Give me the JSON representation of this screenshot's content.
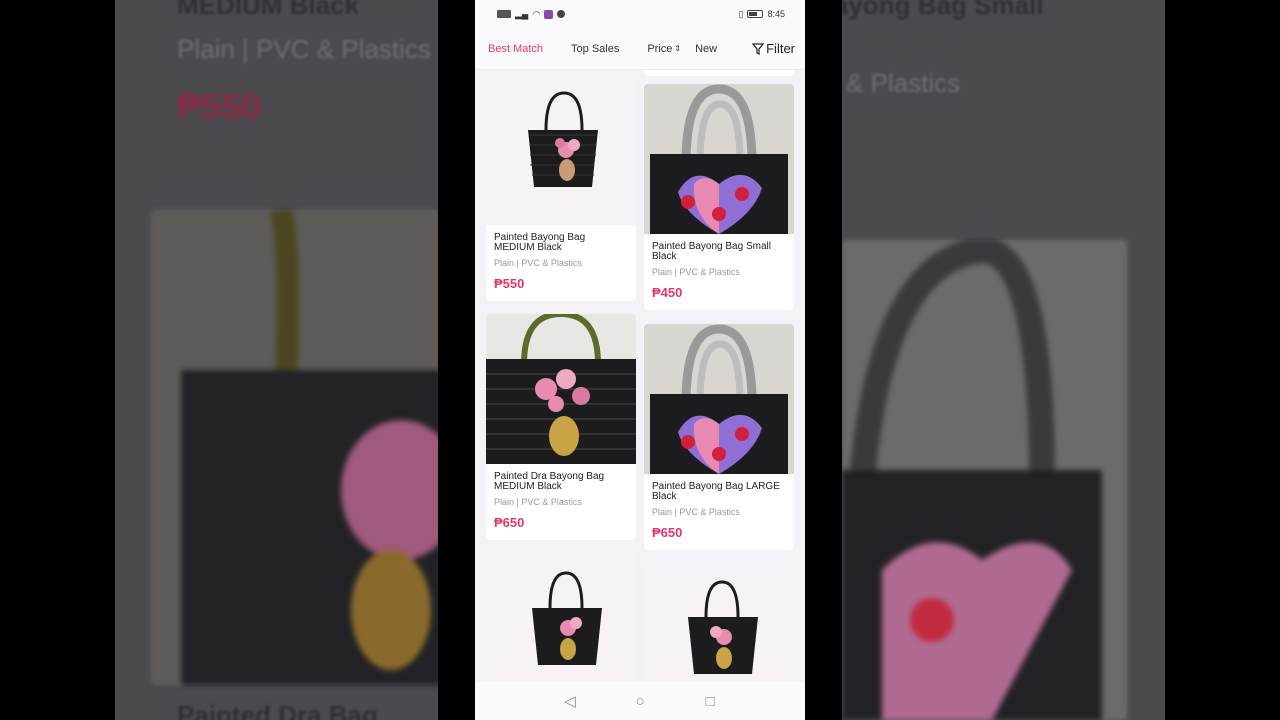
{
  "background": {
    "left_title": "MEDIUM Black",
    "left_sub": "Plain | PVC & Plastics",
    "left_price": "₱550",
    "left_bottom_title": "Painted Dra Bag",
    "right_title": "ayong Bag Small",
    "right_sub": "& Plastics"
  },
  "status": {
    "time": "8:45",
    "left_label": "WiFi"
  },
  "sort": {
    "best_match": "Best Match",
    "top_sales": "Top Sales",
    "price": "Price",
    "new": "New",
    "filter": "Filter"
  },
  "products": [
    {
      "title": "Painted Bayong Bag MEDIUM Black",
      "meta": "Plain | PVC & Plastics",
      "price": "₱550"
    },
    {
      "title": "Painted Bayong Bag Small Black",
      "meta": "Plain | PVC & Plastics",
      "price": "₱450"
    },
    {
      "title": "Painted Dra Bayong Bag MEDIUM Black",
      "meta": "Plain | PVC & Plastics",
      "price": "₱650"
    },
    {
      "title": "Painted Bayong Bag LARGE Black",
      "meta": "Plain | PVC & Plastics",
      "price": "₱650"
    }
  ],
  "colors": {
    "accent": "#e0386b",
    "bag_black": "#1c1c1e",
    "heart_pink": "#e98bb0",
    "heart_purple": "#8f6fd6",
    "heart_red": "#d11f3c"
  }
}
